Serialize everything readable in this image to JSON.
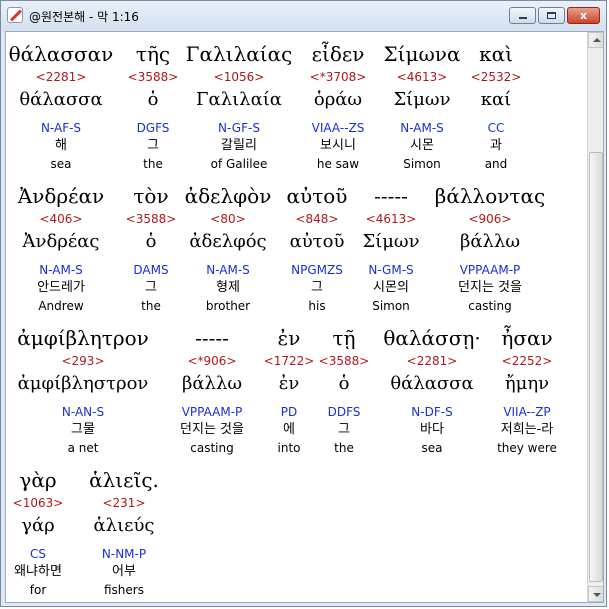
{
  "window": {
    "title": "@원전본해 - 막 1:16",
    "close_glyph": "x"
  },
  "words": [
    {
      "greek": "θάλασσαν",
      "strong": "<2281>",
      "lemma": "θάλασσα",
      "parse": "N-AF-S",
      "korean": "해",
      "english": "sea"
    },
    {
      "greek": "τῆς",
      "strong": "<3588>",
      "lemma": "ὁ",
      "parse": "DGFS",
      "korean": "그",
      "english": "the"
    },
    {
      "greek": "Γαλιλαίας",
      "strong": "<1056>",
      "lemma": "Γαλιλαία",
      "parse": "N-GF-S",
      "korean": "갈릴리",
      "english": "of Galilee"
    },
    {
      "greek": "εἶδεν",
      "strong": "<*3708>",
      "lemma": "ὁράω",
      "parse": "VIAA--ZS",
      "korean": "보시니",
      "english": "he saw"
    },
    {
      "greek": "Σίμωνα",
      "strong": "<4613>",
      "lemma": "Σίμων",
      "parse": "N-AM-S",
      "korean": "시몬",
      "english": "Simon"
    },
    {
      "greek": "καὶ",
      "strong": "<2532>",
      "lemma": "καί",
      "parse": "CC",
      "korean": "과",
      "english": "and"
    },
    {
      "greek": "Ἀνδρέαν",
      "strong": "<406>",
      "lemma": "Ἀνδρέας",
      "parse": "N-AM-S",
      "korean": "안드레가",
      "english": "Andrew"
    },
    {
      "greek": "τὸν",
      "strong": "<3588>",
      "lemma": "ὁ",
      "parse": "DAMS",
      "korean": "그",
      "english": "the"
    },
    {
      "greek": "ἀδελφὸν",
      "strong": "<80>",
      "lemma": "ἀδελφός",
      "parse": "N-AM-S",
      "korean": "형제",
      "english": "brother"
    },
    {
      "greek": "αὐτοῦ",
      "strong": "<848>",
      "lemma": "αὐτοῦ",
      "parse": "NPGMZS",
      "korean": "그",
      "english": "his"
    },
    {
      "greek": "-----",
      "strong": "<4613>",
      "lemma": "Σίμων",
      "parse": "N-GM-S",
      "korean": "시몬의",
      "english": "Simon"
    },
    {
      "greek": "βάλλοντας",
      "strong": "<906>",
      "lemma": "βάλλω",
      "parse": "VPPAAM-P",
      "korean": "던지는 것을",
      "english": "casting"
    },
    {
      "greek": "ἀμφίβλητρον",
      "strong": "<293>",
      "lemma": "ἀμφίβληστρον",
      "parse": "N-AN-S",
      "korean": "그물",
      "english": "a net"
    },
    {
      "greek": "-----",
      "strong": "<*906>",
      "lemma": "βάλλω",
      "parse": "VPPAAM-P",
      "korean": "던지는 것을",
      "english": "casting"
    },
    {
      "greek": "ἐν",
      "strong": "<1722>",
      "lemma": "ἐν",
      "parse": "PD",
      "korean": "에",
      "english": "into"
    },
    {
      "greek": "τῇ",
      "strong": "<3588>",
      "lemma": "ὁ",
      "parse": "DDFS",
      "korean": "그",
      "english": "the"
    },
    {
      "greek": "θαλάσσῃ·",
      "strong": "<2281>",
      "lemma": "θάλασσα",
      "parse": "N-DF-S",
      "korean": "바다",
      "english": "sea"
    },
    {
      "greek": "ἦσαν",
      "strong": "<2252>",
      "lemma": "ἤμην",
      "parse": "VIIA--ZP",
      "korean": "저희는-라",
      "english": "they were"
    },
    {
      "greek": "γὰρ",
      "strong": "<1063>",
      "lemma": "γάρ",
      "parse": "CS",
      "korean": "왜냐하면",
      "english": "for"
    },
    {
      "greek": "ἁλιεῖς.",
      "strong": "<231>",
      "lemma": "ἁλιεύς",
      "parse": "N-NM-P",
      "korean": "어부",
      "english": "fishers"
    }
  ]
}
